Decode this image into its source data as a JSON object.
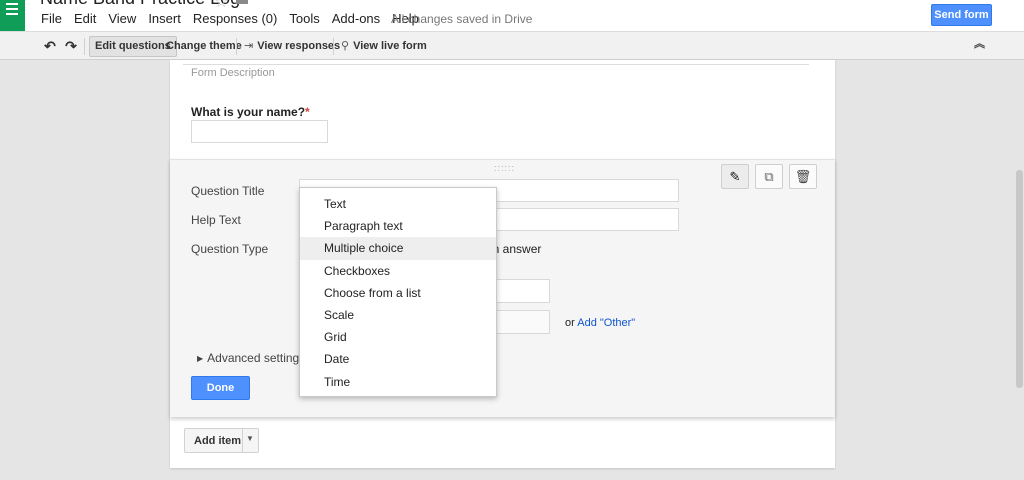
{
  "app": {
    "title": "Name Band Practice Log",
    "icon": "forms-app-icon",
    "accent": "#0f9d58"
  },
  "menu": {
    "items": [
      "File",
      "Edit",
      "View",
      "Insert",
      "Responses (0)",
      "Tools",
      "Add-ons",
      "Help"
    ],
    "save_status": "All changes saved in Drive",
    "send_label": "Send form",
    "send_color": "#4d90fe"
  },
  "toolbar": {
    "undo_icon": "undo-icon",
    "redo_icon": "redo-icon",
    "edit_questions": "Edit questions",
    "change_theme": "Change theme",
    "view_responses": "View responses",
    "view_live_form": "View live form",
    "collapse_icon": "collapse-up-icon"
  },
  "form": {
    "description_placeholder": "Form Description",
    "question1": {
      "title": "What is your name?",
      "required_mark": "*"
    }
  },
  "editor": {
    "question_title_label": "Question Title",
    "help_text_label": "Help Text",
    "question_type_label": "Question Type",
    "required_text": "on answer",
    "or_text": "or",
    "add_other": "Add \"Other\"",
    "advanced_settings": "Advanced settings",
    "done_label": "Done",
    "drag_handle": "::::::",
    "actions": [
      "edit-icon",
      "duplicate-icon",
      "delete-icon"
    ]
  },
  "question_type_dropdown": {
    "selected": "Multiple choice",
    "options": [
      "Text",
      "Paragraph text",
      "Multiple choice",
      "Checkboxes",
      "Choose from a list",
      "Scale",
      "Grid",
      "Date",
      "Time"
    ]
  },
  "add_item": {
    "label": "Add item"
  }
}
